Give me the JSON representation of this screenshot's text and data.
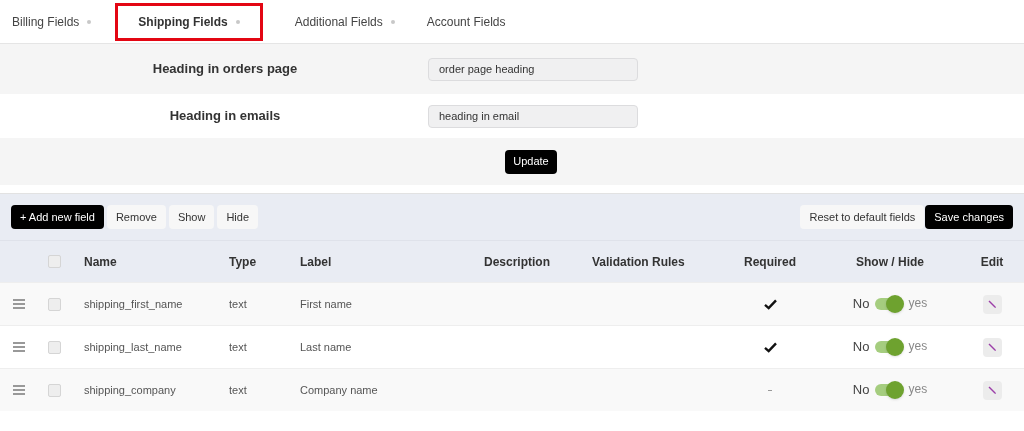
{
  "tabs": [
    {
      "label": "Billing Fields",
      "selected": false,
      "separator": true
    },
    {
      "label": "Shipping Fields",
      "selected": true,
      "separator": true
    },
    {
      "label": "Additional Fields",
      "selected": false,
      "separator": true
    },
    {
      "label": "Account Fields",
      "selected": false,
      "separator": false
    }
  ],
  "settings": [
    {
      "label": "Heading in orders page",
      "value": "order page heading"
    },
    {
      "label": "Heading in emails",
      "value": "heading in email"
    }
  ],
  "update_button": "Update",
  "toolbar": {
    "left": [
      {
        "label": "+ Add new field",
        "kind": "primary"
      },
      {
        "label": "Remove",
        "kind": "plain"
      },
      {
        "label": "Show",
        "kind": "plain"
      },
      {
        "label": "Hide",
        "kind": "plain"
      }
    ],
    "right": [
      {
        "label": "Reset to default fields",
        "kind": "plain"
      },
      {
        "label": "Save changes",
        "kind": "primary"
      }
    ]
  },
  "table": {
    "select_all_checked": false,
    "columns": [
      "Name",
      "Type",
      "Label",
      "Description",
      "Validation Rules",
      "Required",
      "Show / Hide",
      "Edit"
    ],
    "rows": [
      {
        "checked": false,
        "name": "shipping_first_name",
        "type": "text",
        "label": "First name",
        "required": true,
        "off_label": "No",
        "on_label": "yes",
        "on": true
      },
      {
        "checked": false,
        "name": "shipping_last_name",
        "type": "text",
        "label": "Last name",
        "required": true,
        "off_label": "No",
        "on_label": "yes",
        "on": true
      },
      {
        "checked": false,
        "name": "shipping_company",
        "type": "text",
        "label": "Company name",
        "required": false,
        "off_label": "No",
        "on_label": "yes",
        "on": true
      }
    ]
  }
}
